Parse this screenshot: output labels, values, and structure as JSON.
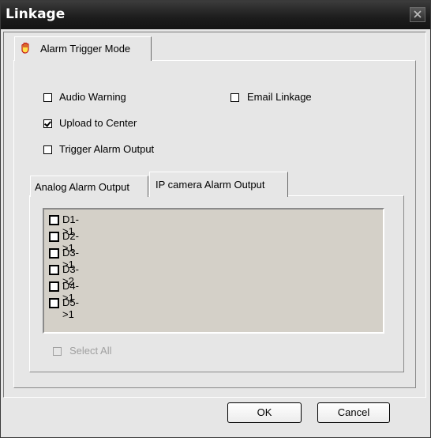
{
  "window": {
    "title": "Linkage",
    "close_icon": "close-icon"
  },
  "main_tab": {
    "label": "Alarm Trigger Mode",
    "icon": "hand-icon"
  },
  "options": {
    "audio_warning": {
      "label": "Audio Warning",
      "checked": false
    },
    "email_linkage": {
      "label": "Email Linkage",
      "checked": false
    },
    "upload_to_center": {
      "label": "Upload to Center",
      "checked": true
    },
    "trigger_alarm_output": {
      "label": "Trigger Alarm Output",
      "checked": false
    }
  },
  "sub_tabs": [
    {
      "label": "Analog Alarm Output",
      "active": false
    },
    {
      "label": "IP camera Alarm Output",
      "active": true
    }
  ],
  "outputs": [
    {
      "label": "D1->1",
      "checked": false
    },
    {
      "label": "D2->1",
      "checked": false
    },
    {
      "label": "D3->1",
      "checked": false
    },
    {
      "label": "D3->2",
      "checked": false
    },
    {
      "label": "D4->1",
      "checked": false
    },
    {
      "label": "D5->1",
      "checked": false
    }
  ],
  "select_all": {
    "label": "Select All",
    "enabled": false
  },
  "buttons": {
    "ok": "OK",
    "cancel": "Cancel"
  }
}
